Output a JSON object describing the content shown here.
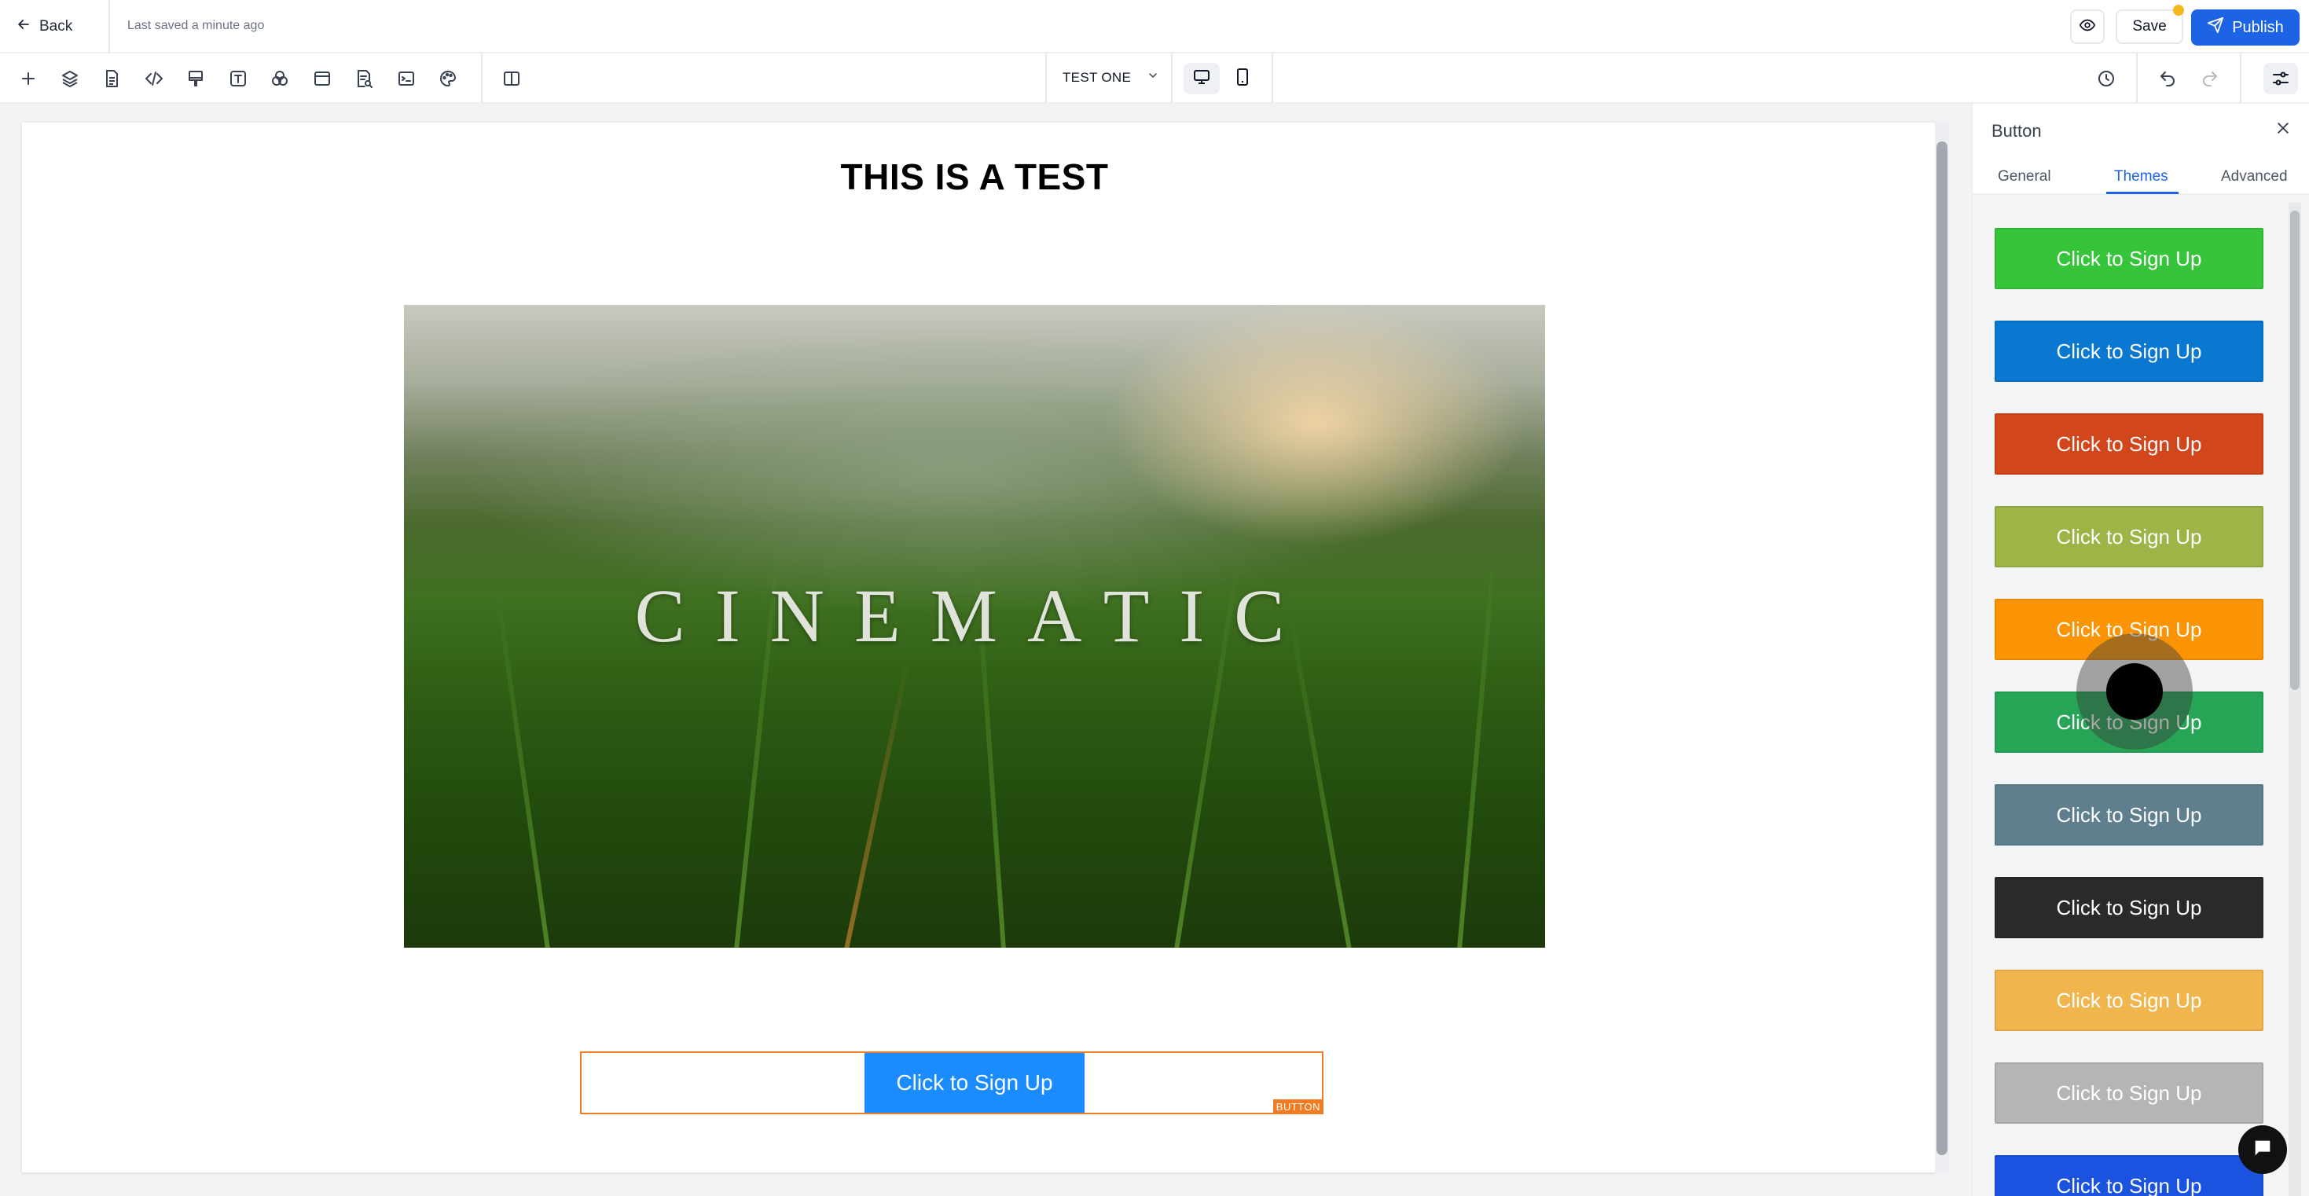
{
  "header": {
    "back_label": "Back",
    "saved_status": "Last saved a minute ago",
    "save_label": "Save",
    "publish_label": "Publish"
  },
  "toolbar": {
    "tools": [
      "add-icon",
      "layers-icon",
      "pages-icon",
      "code-icon",
      "paint-icon",
      "text-icon",
      "color-icon",
      "layout-icon",
      "form-icon",
      "terminal-icon",
      "theme-icon",
      "split-view-icon"
    ],
    "page_name": "TEST ONE",
    "device_active": "desktop"
  },
  "canvas": {
    "title": "THIS IS A TEST",
    "hero_word": "CINEMATIC",
    "button_label": "Click to Sign Up",
    "selection_tag": "BUTTON"
  },
  "panel": {
    "title": "Button",
    "tabs": [
      "General",
      "Themes",
      "Advanced"
    ],
    "active_tab": "Themes",
    "themes": [
      {
        "label": "Click to Sign Up",
        "bg": "#36c43a",
        "fg": "#ffffff"
      },
      {
        "label": "Click to Sign Up",
        "bg": "#0a78d1",
        "fg": "#ffffff"
      },
      {
        "label": "Click to Sign Up",
        "bg": "#d2461b",
        "fg": "#ffffff"
      },
      {
        "label": "Click to Sign Up",
        "bg": "#9db446",
        "fg": "#ffffff"
      },
      {
        "label": "Click to Sign Up",
        "bg": "#fb9404",
        "fg": "#ffffff"
      },
      {
        "label": "Click to Sign Up",
        "bg": "#26a557",
        "fg": "#ffffff"
      },
      {
        "label": "Click to Sign Up",
        "bg": "#5f7f8e",
        "fg": "#ffffff"
      },
      {
        "label": "Click to Sign Up",
        "bg": "#2a2a2a",
        "fg": "#ffffff"
      },
      {
        "label": "Click to Sign Up",
        "bg": "#f1b54e",
        "fg": "#ffffff"
      },
      {
        "label": "Click to Sign Up",
        "bg": "#b5b5b5",
        "fg": "#ffffff"
      },
      {
        "label": "Click to Sign Up",
        "bg": "#1a53e0",
        "fg": "#ffffff"
      }
    ]
  },
  "colors": {
    "accent": "#1d63e6",
    "selection": "#f07b22",
    "canvas_button": "#1a8cff"
  }
}
